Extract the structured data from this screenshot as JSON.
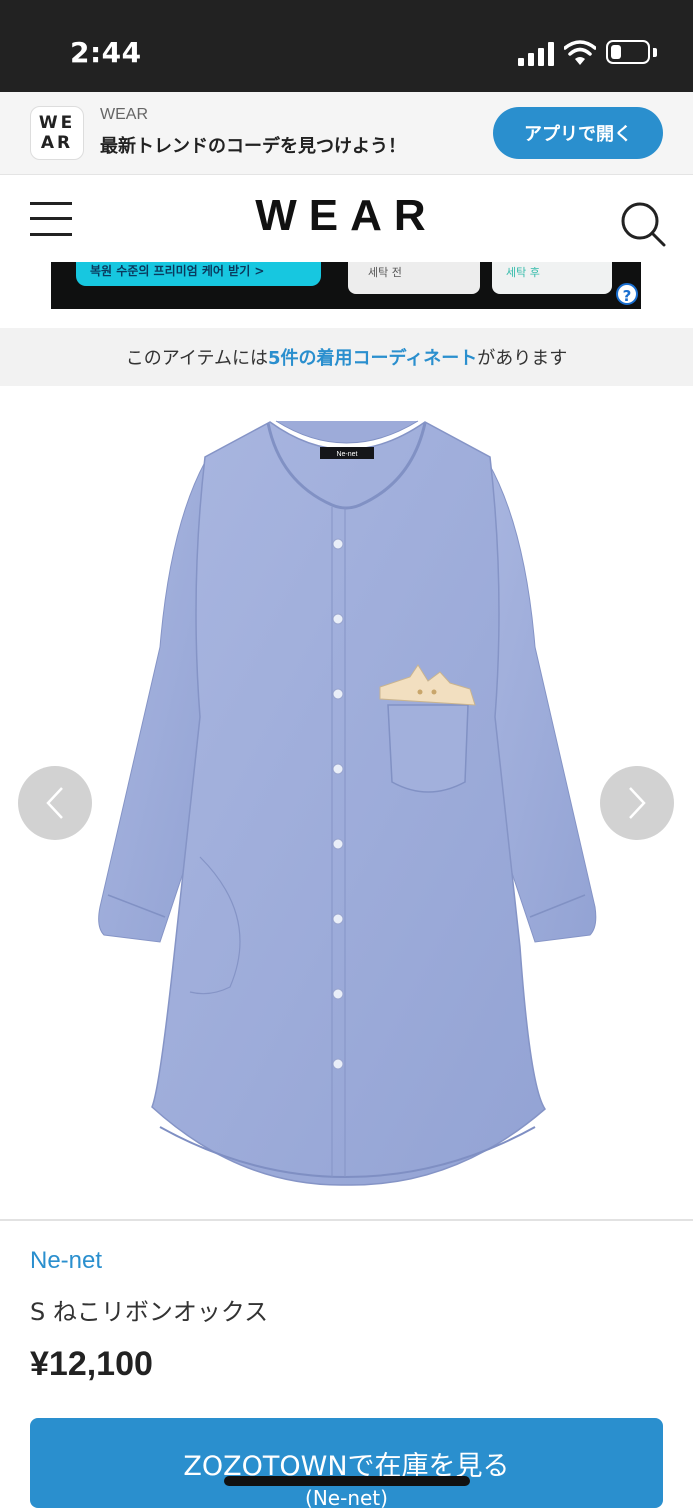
{
  "status_bar": {
    "time": "2:44",
    "battery_level": 0.3
  },
  "app_banner": {
    "logo_text": "WE AR",
    "app_name": "WEAR",
    "tagline": "最新トレンドのコーデを見つけよう！",
    "open_button": "アプリで開く"
  },
  "header": {
    "logo": "WEAR"
  },
  "ad": {
    "pill_text": "복원 수준의 프리미엄 케어 받기 >",
    "before_label": "세탁 전",
    "after_label": "세탁 후",
    "info_icon": "?"
  },
  "coord_notice": {
    "prefix": "このアイテムには",
    "link": "5件の着用コーディネート",
    "suffix": "があります"
  },
  "product": {
    "brand": "Ne-net",
    "name": "S ねこリボンオックス",
    "price": "¥12,100",
    "tag_text": "Ne-net"
  },
  "zozo_button": {
    "label": "ZOZOTOWNで在庫を見る",
    "sublabel": "(Ne-net)"
  }
}
